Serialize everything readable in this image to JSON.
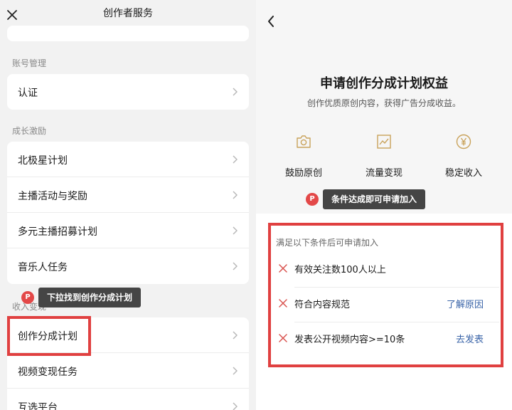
{
  "left": {
    "title": "创作者服务",
    "sections": {
      "account": {
        "label": "账号管理",
        "items": [
          "认证"
        ]
      },
      "growth": {
        "label": "成长激励",
        "items": [
          "北极星计划",
          "主播活动与奖励",
          "多元主播招募计划",
          "音乐人任务"
        ]
      },
      "income": {
        "label": "收入变现",
        "items": [
          "创作分成计划",
          "视频变现任务",
          "互选平台"
        ]
      }
    },
    "tip": {
      "badge": "P",
      "text": "下拉找到创作分成计划"
    }
  },
  "right": {
    "title": "申请创作分成计划权益",
    "subtitle": "创作优质原创内容，获得广告分成收益。",
    "benefits": [
      {
        "icon": "camera-icon",
        "label": "鼓励原创"
      },
      {
        "icon": "trend-chart-icon",
        "label": "流量变现"
      },
      {
        "icon": "yen-coin-icon",
        "label": "稳定收入"
      }
    ],
    "tip": {
      "badge": "P",
      "text": "条件达成即可申请加入"
    },
    "conditions_header": "满足以下条件后可申请加入",
    "conditions": [
      {
        "text": "有效关注数100人以上",
        "action": ""
      },
      {
        "text": "符合内容规范",
        "action": "了解原因"
      },
      {
        "text": "发表公开视频内容>=10条",
        "action": "去发表"
      }
    ]
  },
  "colors": {
    "highlight": "#e04040",
    "link": "#3a64a8",
    "tip_bg": "#454545",
    "badge": "#e34848"
  }
}
